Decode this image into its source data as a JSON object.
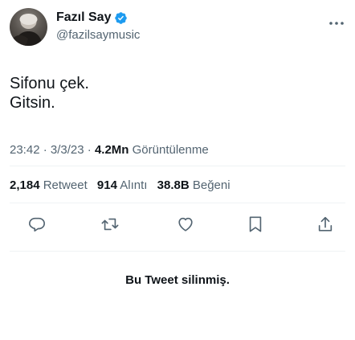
{
  "author": {
    "name": "Fazıl Say",
    "handle": "@fazilsaymusic",
    "verified": true
  },
  "tweet": {
    "lines": [
      "Sifonu çek.",
      "Gitsin."
    ]
  },
  "meta": {
    "time": "23:42",
    "separator": " · ",
    "date": "3/3/23",
    "views_count": "4.2Mn",
    "views_label": "Görüntülenme"
  },
  "stats": {
    "retweets_count": "2,184",
    "retweets_label": "Retweet",
    "quotes_count": "914",
    "quotes_label": "Alıntı",
    "likes_count": "38.8B",
    "likes_label": "Beğeni"
  },
  "actions": {
    "icons": [
      "reply-icon",
      "retweet-icon",
      "like-icon",
      "bookmark-icon",
      "share-icon"
    ]
  },
  "deleted_notice": "Bu Tweet silinmiş.",
  "colors": {
    "text": "#0f1419",
    "secondary": "#536471",
    "verified": "#1d9bf0",
    "divider": "#eff3f4"
  }
}
